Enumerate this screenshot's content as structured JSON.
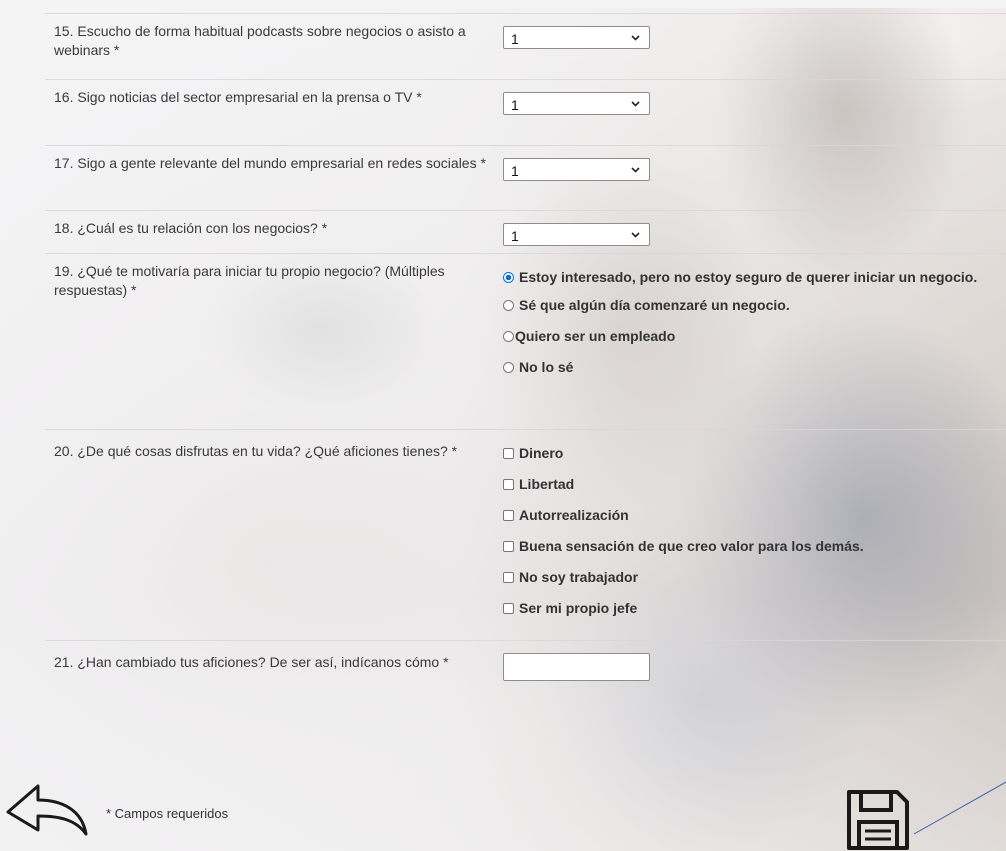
{
  "questions": {
    "q15": {
      "label": "15. Escucho de forma habitual podcasts sobre negocios o asisto a webinars *",
      "value": "1"
    },
    "q16": {
      "label": "16. Sigo noticias del sector empresarial en la prensa o TV *",
      "value": "1"
    },
    "q17": {
      "label": "17. Sigo a gente relevante del mundo empresarial en redes sociales *",
      "value": "1"
    },
    "q18": {
      "label": "18. ¿Cuál es tu relación con los negocios? *",
      "value": "1"
    },
    "q19": {
      "label": "19. ¿Qué te motivaría para iniciar tu propio negocio? (Múltiples respuestas) *",
      "options": [
        "Estoy interesado, pero no estoy seguro de querer iniciar un negocio.",
        "Sé que algún día comenzaré un negocio.",
        "Quiero ser un empleado",
        "No lo sé"
      ],
      "selected": "Estoy interesado, pero no estoy seguro de querer iniciar un negocio."
    },
    "q20": {
      "label": "20. ¿De qué cosas disfrutas en tu vida? ¿Qué aficiones tienes? *",
      "options": [
        "Dinero",
        "Libertad",
        "Autorrealización",
        "Buena sensación de que creo valor para los demás.",
        "No soy trabajador",
        "Ser mi propio jefe"
      ],
      "checked": []
    },
    "q21": {
      "label": "21. ¿Han cambiado tus aficiones? De ser así, indícanos cómo *",
      "value": ""
    }
  },
  "footer": {
    "required_note": "* Campos requeridos"
  },
  "icons": {
    "back": "back-arrow-icon",
    "save": "save-disk-icon",
    "select_chevron": "chevron-down-icon"
  },
  "colors": {
    "radio_selected": "#0b6bd3",
    "text": "#333333"
  }
}
